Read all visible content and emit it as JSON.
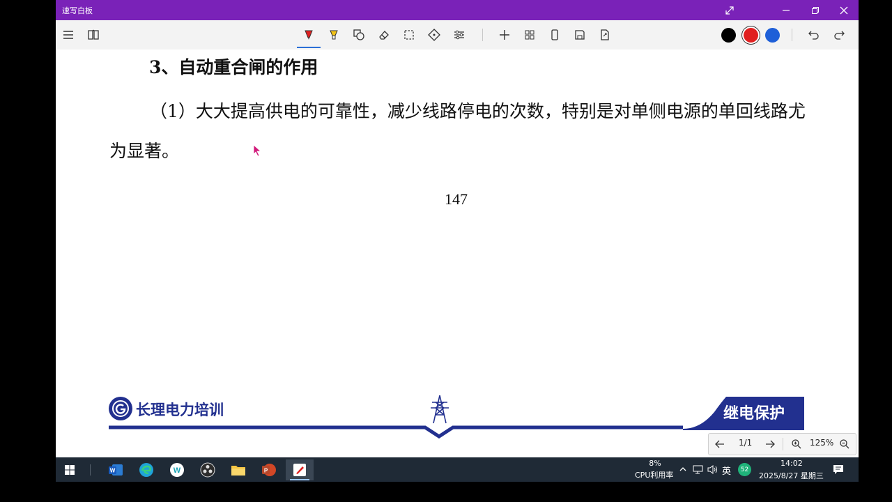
{
  "window": {
    "title": "速写白板"
  },
  "document": {
    "heading": "3、自动重合闸的作用",
    "paragraph": "（1）大大提高供电的可靠性，减少线路停电的次数，特别是对单侧电源的单回线路尤为显著。",
    "page_number": "147",
    "logo_text": "长理电力培训",
    "footer_tag": "继电保护"
  },
  "toolbar": {
    "colors": [
      "#000000",
      "#e02020",
      "#1e5fd8"
    ],
    "selected_color": "#e02020",
    "active_tool": "pen"
  },
  "nav": {
    "page": "1/1",
    "zoom": "125%"
  },
  "taskbar": {
    "cpu_percent": "8%",
    "cpu_label": "CPU利用率",
    "ime": "英",
    "badge": "52",
    "time": "14:02",
    "date": "2025/8/27 星期三"
  },
  "accent_colors": {
    "titlebar": "#7a22b8",
    "brand_blue": "#22308f"
  }
}
